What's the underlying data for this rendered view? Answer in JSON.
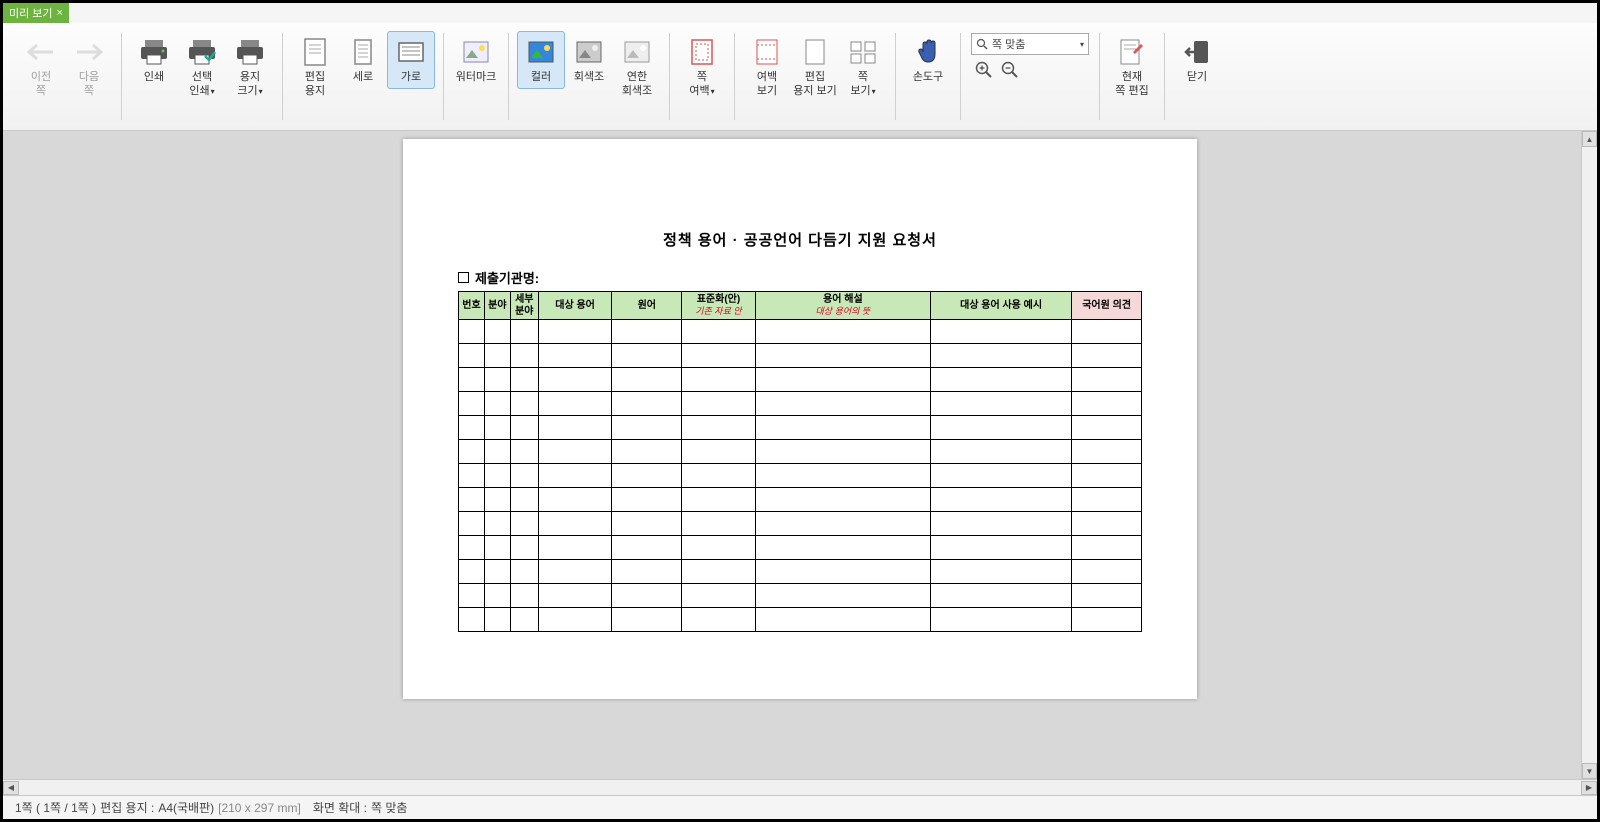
{
  "tab": {
    "title": "미리 보기"
  },
  "ribbon": {
    "prev_page": "이전\n쪽",
    "next_page": "다음\n쪽",
    "print": "인쇄",
    "select_print": "선택\n인쇄",
    "paper_size": "용지\n크기",
    "duplex": "편집\n용지",
    "vertical": "세로",
    "width_fit": "가로",
    "watermark": "워터마크",
    "color": "컬러",
    "grayscale": "회색조",
    "soft_gray": "연한\n회색조",
    "page_margin": "쪽\n여백",
    "margin_view": "여백\n보기",
    "edit_paper_view": "편집\n용지 보기",
    "page_view": "쪽\n보기",
    "hand_tool": "손도구",
    "zoom_select": "쪽 맞춤",
    "current_page_edit": "현재\n쪽 편집",
    "close": "닫기"
  },
  "document": {
    "title": "정책 용어 · 공공언어 다듬기 지원 요청서",
    "subheading": "제출기관명:",
    "headers": {
      "no": "번호",
      "field": "분야",
      "sub_field": "세부\n분야",
      "target_term": "대상 용어",
      "original": "원어",
      "standard": "표준화(안)",
      "standard_sub": "기존 자료 안",
      "explanation": "용어 해설",
      "explanation_sub": "대상 용어의 뜻",
      "usage_example": "대상 용어 사용 예시",
      "opinion": "국어원 의견"
    },
    "rows": 13
  },
  "status": {
    "page_info": "1쪽 ( 1쪽 / 1쪽 )",
    "paper_label": "편집 용지 :",
    "paper_value": "A4(국배판)",
    "paper_dim": "[210 x 297 mm]",
    "zoom_label": "화면 확대 :",
    "zoom_value": "쪽 맞춤"
  }
}
